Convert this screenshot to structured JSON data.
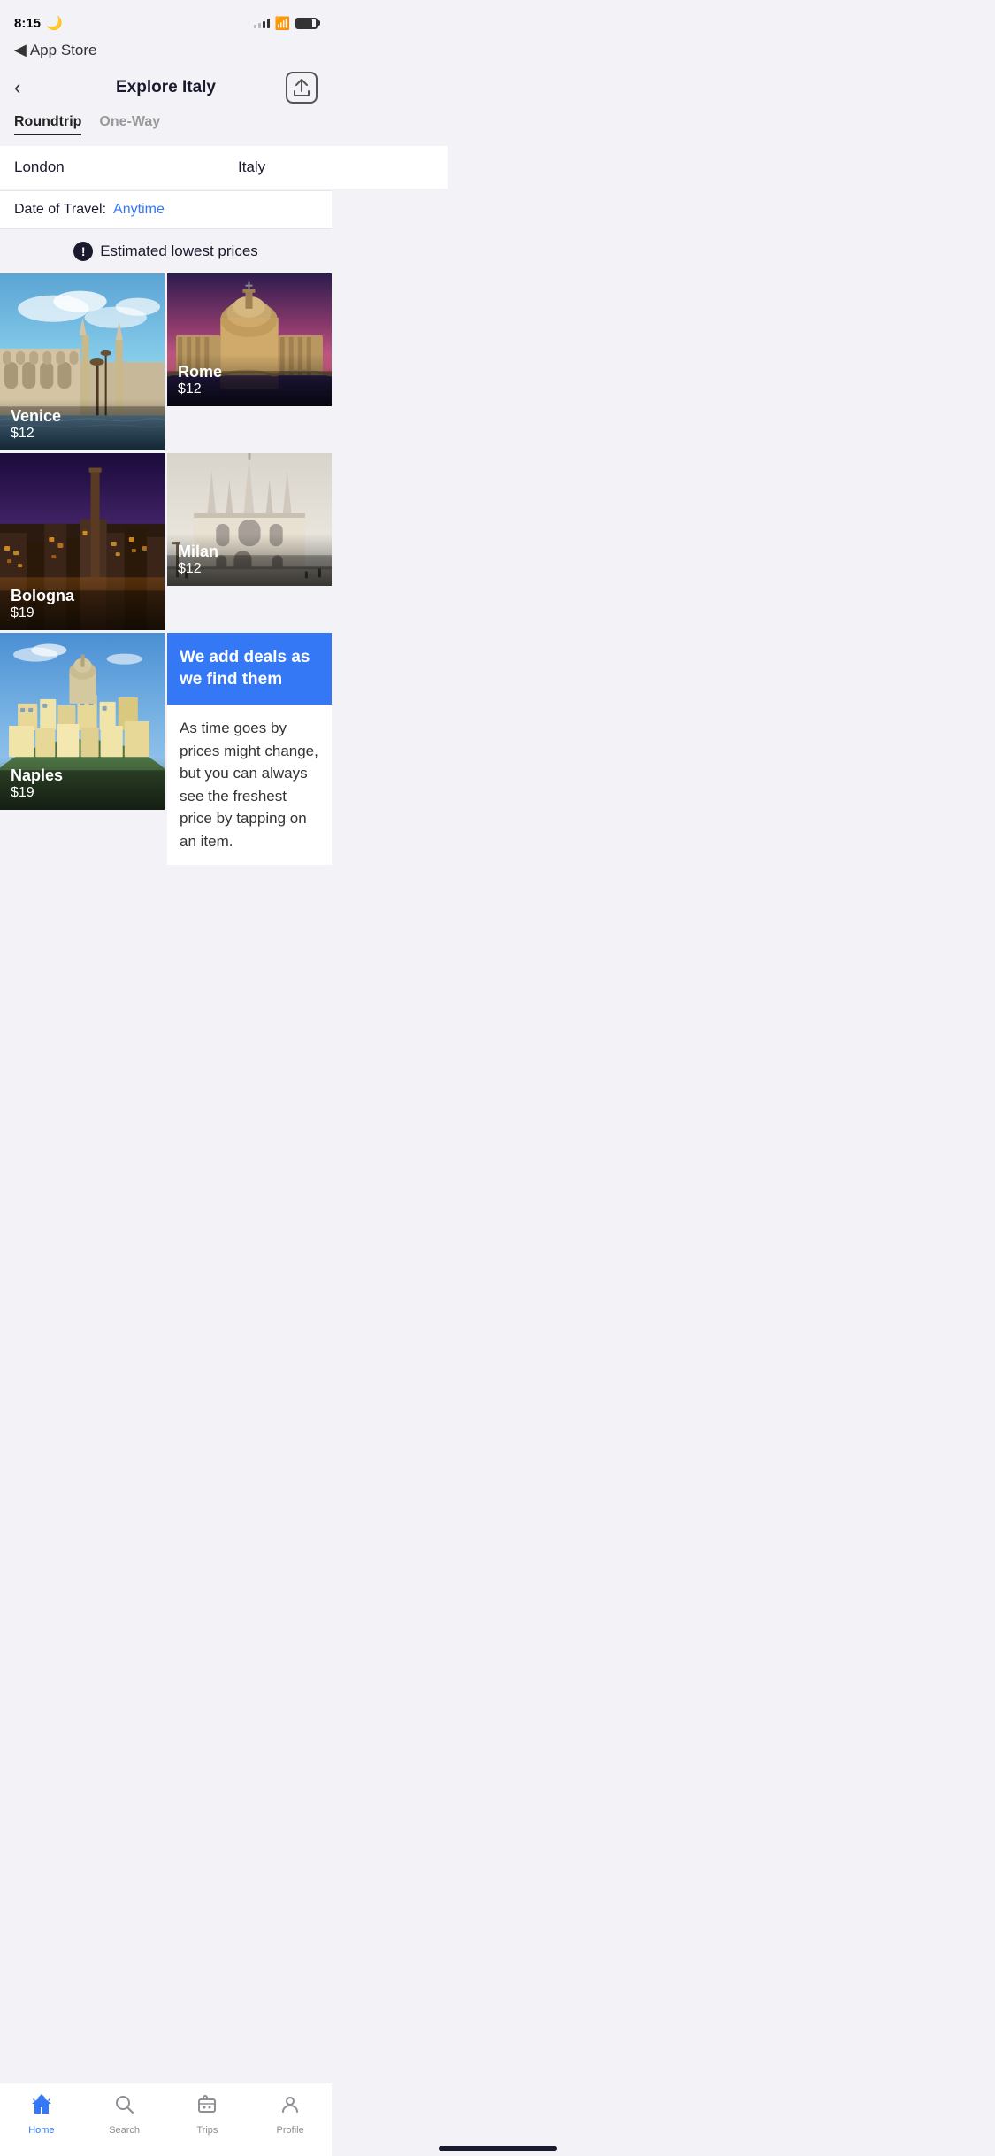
{
  "statusBar": {
    "time": "8:15",
    "moonIcon": "🌙"
  },
  "backNav": {
    "arrow": "◀",
    "label": "App Store"
  },
  "header": {
    "backArrow": "<",
    "title": "Explore Italy",
    "shareIcon": "↑"
  },
  "tripTabs": [
    {
      "label": "Roundtrip",
      "active": true
    },
    {
      "label": "One-Way",
      "active": false
    }
  ],
  "searchFields": {
    "origin": "London",
    "destination": "Italy"
  },
  "dateRow": {
    "label": "Date of Travel:",
    "value": "Anytime"
  },
  "estimatedPrices": {
    "icon": "!",
    "label": "Estimated lowest prices"
  },
  "destinations": [
    {
      "name": "Venice",
      "price": "$12",
      "colorScheme": "venice"
    },
    {
      "name": "Rome",
      "price": "$12",
      "colorScheme": "rome"
    },
    {
      "name": "Bologna",
      "price": "$19",
      "colorScheme": "bologna"
    },
    {
      "name": "Milan",
      "price": "$12",
      "colorScheme": "milan"
    },
    {
      "name": "Naples",
      "price": "$19",
      "colorScheme": "naples"
    }
  ],
  "infoCard": {
    "title": "We add deals as we find them",
    "description": "As time goes by prices might change, but you can always see the freshest price by tapping on an item."
  },
  "tabBar": {
    "items": [
      {
        "icon": "home",
        "label": "Home",
        "active": true
      },
      {
        "icon": "search",
        "label": "Search",
        "active": false
      },
      {
        "icon": "trips",
        "label": "Trips",
        "active": false
      },
      {
        "icon": "profile",
        "label": "Profile",
        "active": false
      }
    ]
  }
}
